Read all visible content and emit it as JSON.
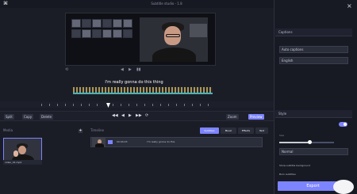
{
  "window": {
    "title": "Subtitle studio - 1.8",
    "close_icon": "close-icon"
  },
  "preview": {
    "subtitle_text": "I'm really gonna do this thing",
    "controls": [
      "⟲",
      "◀",
      "▶",
      "▮▮"
    ]
  },
  "toolbar": {
    "left": [
      "Split",
      "Copy",
      "Delete"
    ],
    "right": [
      "Zoom",
      "Preview"
    ],
    "media": [
      "◀◀",
      "◀",
      "▶",
      "▶▶",
      "⟳"
    ],
    "primary": "Preview"
  },
  "lower": {
    "media_label": "Media",
    "timeline_label": "Timeline",
    "add_button": "+",
    "media_caption": "video_01.mp4",
    "track_text_1": "00:00:03",
    "track_text_2": "I'm really gonna do this",
    "track_pills": [
      "Subtitles",
      "Music",
      "Effects",
      "Text"
    ]
  },
  "sidebar": {
    "header_1": "Captions",
    "header_2": "Style",
    "field_1": "Auto captions",
    "field_2": "English",
    "field_3": "Normal",
    "slider_label": "Size",
    "checkbox_1": "Show subtitle background",
    "checkbox_2": "Burn subtitles",
    "export": "Export"
  },
  "colors": {
    "accent": "#7d84ff",
    "background": "#1b1d26",
    "panel": "#181a23",
    "wave_yellow": "#d1b45e",
    "wave_teal": "#43b5bc"
  }
}
